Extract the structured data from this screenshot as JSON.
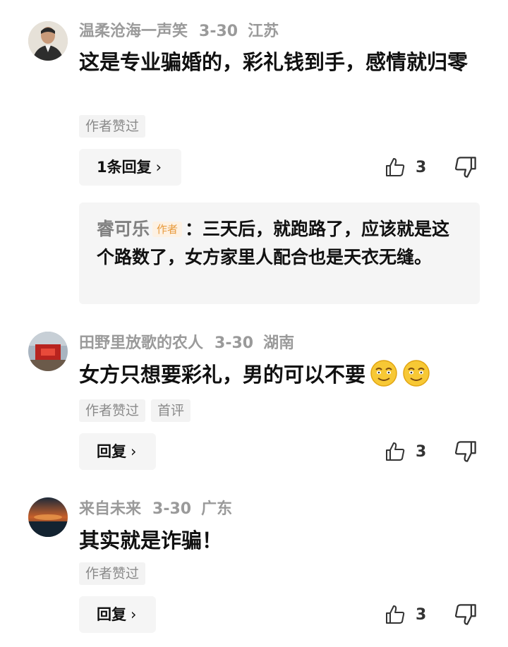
{
  "comments": [
    {
      "username": "温柔沧海一声笑",
      "date": "3-30",
      "location": "江苏",
      "text": "这是专业骗婚的，彩礼钱到手，感情就归零",
      "tags": [
        "作者赞过"
      ],
      "reply_label": "1条回复",
      "likes": "3",
      "sub_reply": {
        "name": "睿可乐",
        "badge": "作者",
        "text": "：三天后，就跑路了，应该就是这个路数了，女方家里人配合也是天衣无缝。"
      }
    },
    {
      "username": "田野里放歌的农人",
      "date": "3-30",
      "location": "湖南",
      "text": "女方只想要彩礼，男的可以不要",
      "tags": [
        "作者赞过",
        "首评"
      ],
      "reply_label": "回复",
      "likes": "3"
    },
    {
      "username": "来自未来",
      "date": "3-30",
      "location": "广东",
      "text": "其实就是诈骗！",
      "tags": [
        "作者赞过"
      ],
      "reply_label": "回复",
      "likes": "3"
    }
  ],
  "icons": {
    "like": "thumbs-up-icon",
    "dislike": "thumbs-down-icon",
    "chevron": "chevron-right-icon",
    "emoji": "smiling-face-emoji"
  },
  "colors": {
    "meta_text": "#9a9a9a",
    "badge_text": "#e89a3c",
    "button_bg": "#f5f5f5"
  }
}
